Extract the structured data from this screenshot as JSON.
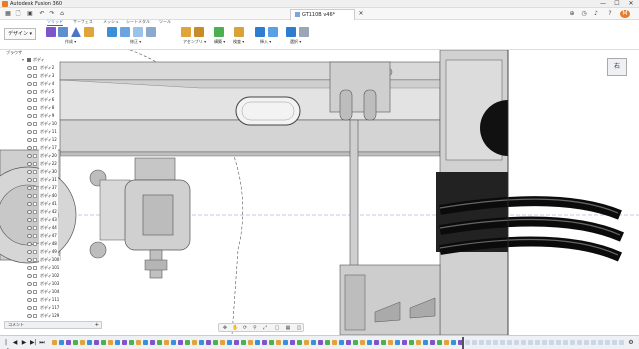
{
  "titlebar": {
    "app_title": "Autodesk Fusion 360",
    "minimize_label": "—",
    "maximize_label": "☐",
    "close_label": "✕"
  },
  "quickaccess": {
    "grid_icon": "grid-icon",
    "file_icon": "file-icon",
    "save_icon": "save-icon",
    "undo_icon": "undo-icon",
    "redo_icon": "redo-icon",
    "home_icon": "home-icon",
    "document_tab": "GT110B v46*",
    "close_tab": "✕",
    "new_tab": "+",
    "right_icons": [
      "add-icon",
      "clock-icon",
      "bell-icon",
      "help-icon",
      "user-icon"
    ]
  },
  "ribbon": {
    "design_label": "デザイン ▾",
    "tabs": [
      "ソリッド",
      "サーフェス",
      "メッシュ",
      "シートメタル",
      "ツール"
    ],
    "active_tab": 0,
    "groups": [
      "作成 ▾",
      "修正 ▾",
      "アセンブリ ▾",
      "構築 ▾",
      "検査 ▾",
      "挿入 ▾",
      "選択 ▾"
    ],
    "colors": {
      "accent": "#1a73c8",
      "create": "#7d54c9",
      "modify": "#3a8fd6",
      "assembly": "#e0a43a",
      "construct": "#4caf50",
      "inspect": "#d9a33a",
      "insert": "#2e7dd1",
      "select": "#2e7dd1"
    }
  },
  "viewcube": {
    "face_label": "右"
  },
  "browser": {
    "header": "ブラウザ",
    "root_label": "ボディ",
    "items": [
      "ボディ2",
      "ボディ3",
      "ボディ4",
      "ボディ5",
      "ボディ6",
      "ボディ8",
      "ボディ9",
      "ボディ10",
      "ボディ11",
      "ボディ12",
      "ボディ17",
      "ボディ20",
      "ボディ22",
      "ボディ30",
      "ボディ31",
      "ボディ37",
      "ボディ40",
      "ボディ41",
      "ボディ42",
      "ボディ43",
      "ボディ44",
      "ボディ47",
      "ボディ48",
      "ボディ49",
      "ボディ100",
      "ボディ101",
      "ボディ102",
      "ボディ103",
      "ボディ104",
      "ボディ111",
      "ボディ117",
      "ボディ129",
      "ボディ131"
    ]
  },
  "comments": {
    "label": "コメント",
    "add_icon": "+"
  },
  "navbar": {
    "icons": [
      "move-icon",
      "hand-icon",
      "orbit-icon",
      "zoom-icon",
      "fit-icon",
      "display-icon",
      "grid-display-icon",
      "viewports-icon"
    ]
  },
  "timeline": {
    "controls": [
      "|◀",
      "◀",
      "▶",
      "▶|",
      "⏭"
    ],
    "settings_icon": "⚙",
    "marker_label": "timeline-marker"
  }
}
